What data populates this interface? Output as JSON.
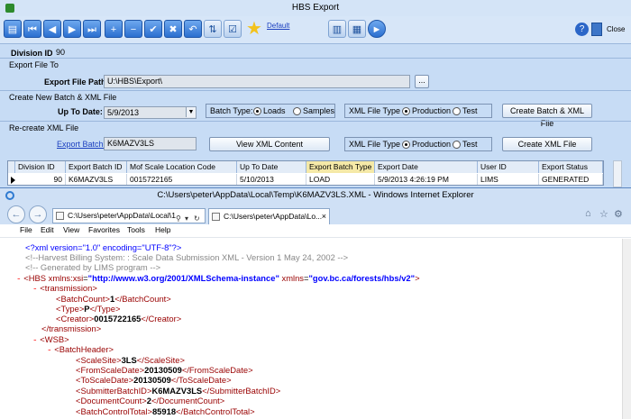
{
  "hbs": {
    "title": "HBS Export",
    "toolbar": {
      "default_link": "Default",
      "close_label": "Close"
    },
    "division": {
      "label": "Division ID",
      "value": "90"
    },
    "export_file_to": {
      "section": "Export File To",
      "path_label": "Export File Path:",
      "path_value": "U:\\HBS\\Export\\",
      "browse_label": "..."
    },
    "create_batch": {
      "section": "Create New Batch & XML File",
      "up_to_date_label": "Up To Date:",
      "up_to_date_value": "5/9/2013",
      "batch_type_label": "Batch Type:",
      "batch_type_options": [
        "Loads",
        "Samples"
      ],
      "xml_type_label": "XML File Type :",
      "xml_type_options": [
        "Production",
        "Test"
      ],
      "button": "Create Batch & XML File"
    },
    "recreate": {
      "section": "Re-create XML File",
      "export_batch_link": "Export Batch ID",
      "export_batch_value": "K6MAZV3LS",
      "view_button": "View XML Content",
      "xml_type_label": "XML File Type :",
      "xml_type_options": [
        "Production",
        "Test"
      ],
      "button": "Create XML File"
    },
    "grid": {
      "columns": [
        "Division ID",
        "Export Batch ID",
        "Mof Scale Location Code",
        "Up To Date",
        "Export Batch Type",
        "Export Date",
        "User ID",
        "Export Status"
      ],
      "rows": [
        [
          "90",
          "K6MAZV3LS",
          "0015722165",
          "5/10/2013",
          "LOAD",
          "5/9/2013 4:26:19 PM",
          "LIMS",
          "GENERATED"
        ]
      ]
    }
  },
  "ie": {
    "title": "C:\\Users\\peter\\AppData\\Local\\Temp\\K6MAZV3LS.XML - Windows Internet Explorer",
    "address": "C:\\Users\\peter\\AppData\\Local\\1",
    "tab_label": "C:\\Users\\peter\\AppData\\Lo...",
    "menu": [
      "File",
      "Edit",
      "View",
      "Favorites",
      "Tools",
      "Help"
    ],
    "xml": {
      "decl": "<?xml version=\"1.0\" encoding=\"UTF-8\"?>",
      "comment1": "<!--Harvest Billing System: : Scale Data Submission XML - Version 1 May 24, 2002 -->",
      "comment2": "<!-- Generated by LIMS program -->",
      "root_open": "<HBS",
      "attr1_name": "xmlns:xsi",
      "attr1_value": "\"http://www.w3.org/2001/XMLSchema-instance\"",
      "attr2_name": "xmlns",
      "attr2_value": "\"gov.bc.ca/forests/hbs/v2\"",
      "transmission": "transmission",
      "batch_count_tag": "BatchCount",
      "batch_count": "1",
      "type_tag": "Type",
      "type_value": "P",
      "creator_tag": "Creator",
      "creator_value": "0015722165",
      "wsb": "WSB",
      "batch_header": "BatchHeader",
      "scale_site_tag": "ScaleSite",
      "scale_site": "3LS",
      "from_date_tag": "FromScaleDate",
      "from_date": "20130509",
      "to_date_tag": "ToScaleDate",
      "to_date": "20130509",
      "submitter_tag": "SubmitterBatchID",
      "submitter": "K6MAZV3LS",
      "doc_count_tag": "DocumentCount",
      "doc_count": "2",
      "control_total_tag": "BatchControlTotal",
      "control_total": "85918"
    }
  },
  "colors": {
    "form_bg": "#c7dcf5",
    "xml_tag": "#990000",
    "xml_value": "#0000ff",
    "xml_comment": "#888888",
    "xml_minus": "#ff0000"
  }
}
